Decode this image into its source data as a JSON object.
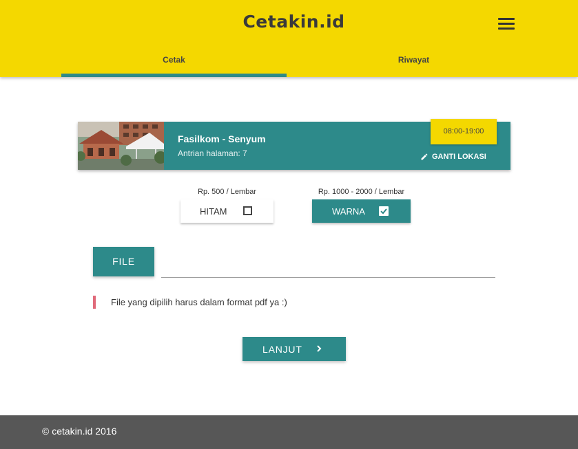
{
  "header": {
    "logo_text": "Cetakin.id",
    "menu_icon": "hamburger-menu-icon",
    "tabs": [
      {
        "label": "Cetak",
        "active": true
      },
      {
        "label": "Riwayat",
        "active": false
      }
    ],
    "colors": {
      "background": "#f4d800",
      "accent": "#2d8a8a"
    }
  },
  "location": {
    "name": "Fasilkom - Senyum",
    "queue": "Antrian halaman: 7",
    "hours": "08:00-19:00",
    "change_label": "GANTI LOKASI",
    "change_icon": "pencil-icon"
  },
  "print_options": {
    "hitam": {
      "price": "Rp. 500 / Lembar",
      "label": "HITAM",
      "checked": false
    },
    "warna": {
      "price": "Rp. 1000 - 2000 / Lembar",
      "label": "WARNA",
      "checked": true
    }
  },
  "file": {
    "button_label": "FILE",
    "path_value": ""
  },
  "notice": {
    "text": "File yang dipilih harus dalam format pdf ya :)"
  },
  "next_button": {
    "label": "LANJUT",
    "icon": "chevron-right-icon"
  },
  "footer": {
    "text": "© cetakin.id 2016",
    "background": "#575757"
  }
}
